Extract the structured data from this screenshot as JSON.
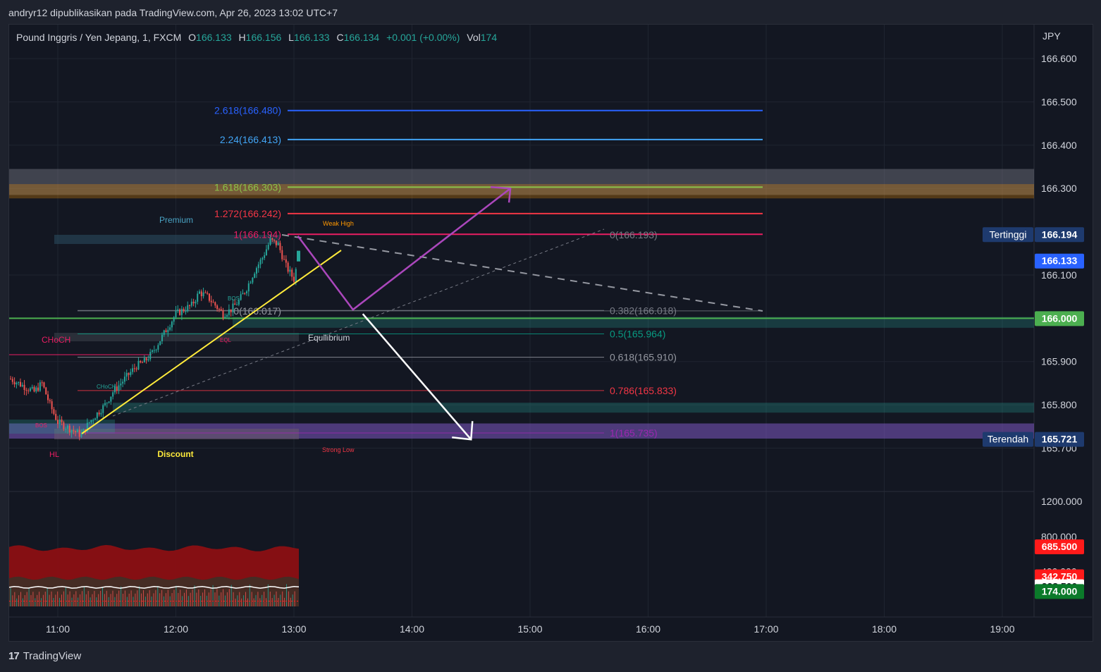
{
  "header": {
    "published_by": "andryr12 dipublikasikan pada TradingView.com, Apr 26, 2023 13:02 UTC+7"
  },
  "legend": {
    "symbol": "Pound Inggris / Yen Jepang, 1, FXCM",
    "o_label": "O",
    "o_value": "166.133",
    "h_label": "H",
    "h_value": "166.156",
    "l_label": "L",
    "l_value": "166.133",
    "c_label": "C",
    "c_value": "166.134",
    "change": "+0.001 (+0.00%)",
    "vol_label": "Vol",
    "vol_value": "174"
  },
  "footer": {
    "brand": "TradingView",
    "logo": "17"
  },
  "colors": {
    "background": "#131722",
    "up": "#26a69a",
    "down": "#ef5350",
    "fib_blue": "#2962ff",
    "fib_lightblue": "#42a5f5",
    "fib_green": "#8bc34a",
    "fib_red": "#f23645",
    "fib_pink": "#e91e63",
    "fib_teal": "#089981",
    "purple_arrow": "#ab47bc",
    "support_green": "#4caf50"
  },
  "chart_data": {
    "type": "candlestick",
    "symbol": "Pound Inggris / Yen Jepang",
    "timeframe": "1",
    "currency": "JPY",
    "x_ticks": [
      "11:00",
      "12:00",
      "13:00",
      "14:00",
      "15:00",
      "16:00",
      "17:00",
      "18:00",
      "19:00"
    ],
    "x_range": [
      "10:36",
      "19:15"
    ],
    "price_ticks": [
      166.6,
      166.5,
      166.4,
      166.3,
      166.1,
      165.9,
      165.8,
      165.7
    ],
    "price_tick_labels": [
      "166.600",
      "166.500",
      "166.400",
      "166.300",
      "166.100",
      "165.900",
      "165.800",
      "165.700"
    ],
    "ylim": [
      165.605,
      166.68
    ],
    "price_badges": [
      {
        "label": "Tertinggi",
        "value": "166.194",
        "price": 166.194,
        "bg": "#1e3a6e"
      },
      {
        "label": "",
        "value": "166.133",
        "price": 166.133,
        "bg": "#2962ff"
      },
      {
        "label": "",
        "value": "166.000",
        "price": 166.0,
        "bg": "#4caf50"
      },
      {
        "label": "Terendah",
        "value": "165.721",
        "price": 165.721,
        "bg": "#1e3a6e"
      }
    ],
    "close_path": [
      [
        "10:36",
        165.86
      ],
      [
        "10:40",
        165.85
      ],
      [
        "10:44",
        165.84
      ],
      [
        "10:48",
        165.83
      ],
      [
        "10:52",
        165.85
      ],
      [
        "10:56",
        165.8
      ],
      [
        "11:00",
        165.76
      ],
      [
        "11:04",
        165.75
      ],
      [
        "11:08",
        165.74
      ],
      [
        "11:12",
        165.73
      ],
      [
        "11:16",
        165.76
      ],
      [
        "11:20",
        165.78
      ],
      [
        "11:24",
        165.8
      ],
      [
        "11:28",
        165.83
      ],
      [
        "11:32",
        165.85
      ],
      [
        "11:36",
        165.87
      ],
      [
        "11:40",
        165.89
      ],
      [
        "11:44",
        165.9
      ],
      [
        "11:48",
        165.92
      ],
      [
        "11:52",
        165.95
      ],
      [
        "11:56",
        165.98
      ],
      [
        "12:00",
        166.01
      ],
      [
        "12:04",
        166.02
      ],
      [
        "12:08",
        166.03
      ],
      [
        "12:12",
        166.06
      ],
      [
        "12:16",
        166.05
      ],
      [
        "12:20",
        166.03
      ],
      [
        "12:24",
        166.01
      ],
      [
        "12:28",
        166.02
      ],
      [
        "12:32",
        166.04
      ],
      [
        "12:36",
        166.07
      ],
      [
        "12:40",
        166.11
      ],
      [
        "12:44",
        166.14
      ],
      [
        "12:48",
        166.18
      ],
      [
        "12:52",
        166.17
      ],
      [
        "12:56",
        166.12
      ],
      [
        "13:00",
        166.09
      ],
      [
        "13:02",
        166.134
      ]
    ],
    "fib_extension": [
      {
        "label": "2.618(166.480)",
        "price": 166.48,
        "color": "#2962ff"
      },
      {
        "label": "2.24(166.413)",
        "price": 166.413,
        "color": "#42a5f5"
      },
      {
        "label": "1.618(166.303)",
        "price": 166.303,
        "color": "#8bc34a"
      },
      {
        "label": "1.272(166.242)",
        "price": 166.242,
        "color": "#f23645"
      },
      {
        "label": "1(166.194)",
        "price": 166.194,
        "color": "#e91e63"
      },
      {
        "label": "0(166.017)",
        "price": 166.017,
        "color": "#9598a1"
      }
    ],
    "fib_retracement": [
      {
        "label": "0(166.193)",
        "price": 166.193,
        "color": "#787b86"
      },
      {
        "label": "0.382(166.018)",
        "price": 166.018,
        "color": "#787b86"
      },
      {
        "label": "0.5(165.964)",
        "price": 165.964,
        "color": "#089981"
      },
      {
        "label": "0.618(165.910)",
        "price": 165.91,
        "color": "#9598a1"
      },
      {
        "label": "0.786(165.833)",
        "price": 165.833,
        "color": "#f23645"
      },
      {
        "label": "1(165.735)",
        "price": 165.735,
        "color": "#9c27b0"
      }
    ],
    "zones": [
      {
        "name": "resistance-zone",
        "from": 166.285,
        "to": 166.345,
        "color": "#787b86"
      },
      {
        "name": "supply-zone",
        "from": 166.277,
        "to": 166.31,
        "color": "#ff9800"
      },
      {
        "name": "green-support-zone",
        "from": 165.978,
        "to": 166.003,
        "color": "#26a69a"
      },
      {
        "name": "teal-zone",
        "from": 165.782,
        "to": 165.805,
        "color": "#26a69a"
      },
      {
        "name": "purple-demand-zone",
        "from": 165.722,
        "to": 165.757,
        "color": "#7e57c2"
      }
    ],
    "smc_labels": {
      "premium": "Premium",
      "weak_high": "Weak High",
      "equilibrium": "Equilibrium",
      "discount": "Discount",
      "strong_low": "Strong Low",
      "choch_left": "CHoCH",
      "choch_small": "CHoCH",
      "bos_top": "BOS",
      "bos_bottom": "BOS",
      "eql": "EQL",
      "hl": "HL"
    },
    "scenario_bullish": [
      [
        "13:02",
        166.19
      ],
      [
        "13:30",
        166.02
      ],
      [
        "14:50",
        166.3
      ]
    ],
    "scenario_bearish": [
      [
        "13:35",
        166.01
      ],
      [
        "14:30",
        165.72
      ]
    ],
    "volume_panel": {
      "ticks": [
        1200.0,
        800.0,
        400.0
      ],
      "tick_labels": [
        "1200.000",
        "800.000",
        "400.000"
      ],
      "ylim": [
        0,
        1400
      ],
      "badges": [
        {
          "value": "685.500",
          "price": 685.5,
          "bg": "#ff1a1a",
          "fg": "#ffffff"
        },
        {
          "value": "342.750",
          "price": 342.75,
          "bg": "#ff1a1a",
          "fg": "#ffffff"
        },
        {
          "value": "228.500",
          "price": 228.5,
          "bg": "#ffffff",
          "fg": "#131722"
        },
        {
          "value": "174.000",
          "price": 174.0,
          "bg": "#0b7a2a",
          "fg": "#ffffff"
        }
      ],
      "upper_band": 685.5,
      "mid_band": 342.75,
      "white_line": 228.5,
      "last_volume": 174.0
    }
  }
}
